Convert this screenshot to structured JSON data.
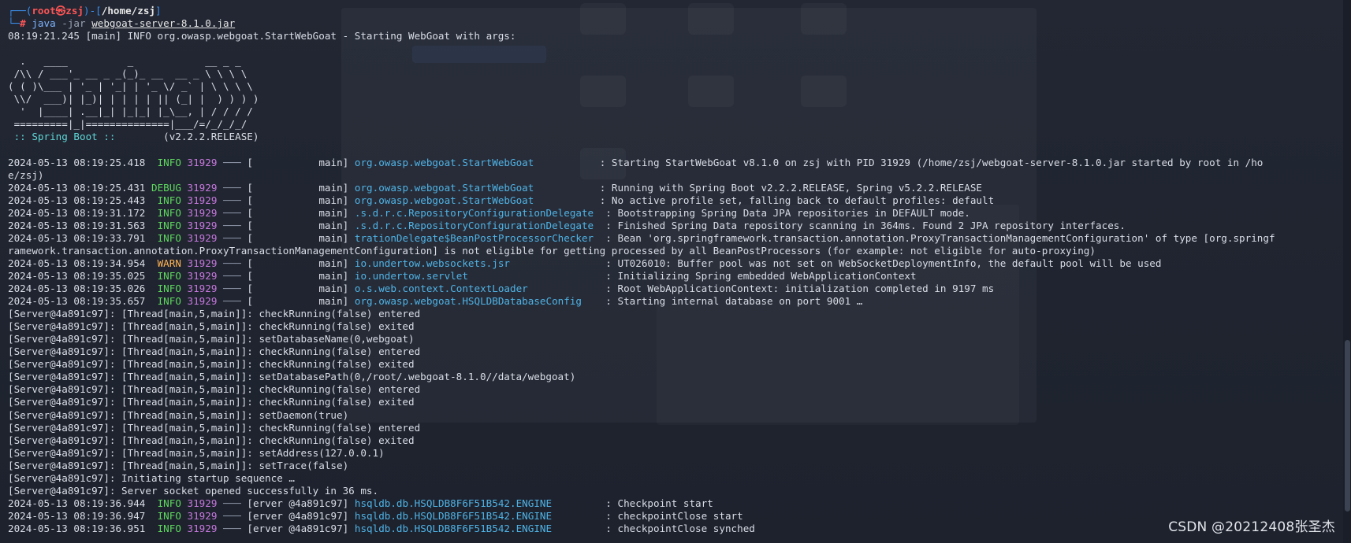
{
  "prompt": {
    "corner_top": "┌──(",
    "user": "root㉿zsj",
    "sep": ")-[",
    "path": "/home/zsj",
    "close": "]",
    "corner_bottom": "└─",
    "symbol": "# ",
    "cmd": "java",
    "arg": " -jar ",
    "file": "webgoat-server-8.1.0.jar"
  },
  "start_line": "08:19:21.245 [main] INFO org.owasp.webgoat.StartWebGoat - Starting WebGoat with args:",
  "banner": [
    "",
    "  .   ____          _            __ _ _",
    " /\\\\ / ___'_ __ _ _(_)_ __  __ _ \\ \\ \\ \\",
    "( ( )\\___ | '_ | '_| | '_ \\/ _` | \\ \\ \\ \\",
    " \\\\/  ___)| |_)| | | | | || (_| |  ) ) ) )",
    "  '  |____| .__|_| |_|_| |_\\__, | / / / /",
    " =========|_|==============|___/=/_/_/_/"
  ],
  "spring_boot": {
    "label": " :: Spring Boot :: ",
    "version": "       (v2.2.2.RELEASE)"
  },
  "log_lines": [
    {
      "type": "log",
      "ts": "2024-05-13 08:19:25.418",
      "level": "INFO",
      "pid": "31929",
      "thread": "[           main]",
      "logger": "org.owasp.webgoat.StartWebGoat          ",
      "msg": ": Starting StartWebGoat v8.1.0 on zsj with PID 31929 (/home/zsj/webgoat-server-8.1.0.jar started by root in /ho"
    },
    {
      "type": "plain",
      "text": "e/zsj)"
    },
    {
      "type": "log",
      "ts": "2024-05-13 08:19:25.431",
      "level": "DEBUG",
      "pid": "31929",
      "thread": "[           main]",
      "logger": "org.owasp.webgoat.StartWebGoat          ",
      "msg": ": Running with Spring Boot v2.2.2.RELEASE, Spring v5.2.2.RELEASE"
    },
    {
      "type": "log",
      "ts": "2024-05-13 08:19:25.443",
      "level": "INFO",
      "pid": "31929",
      "thread": "[           main]",
      "logger": "org.owasp.webgoat.StartWebGoat          ",
      "msg": ": No active profile set, falling back to default profiles: default"
    },
    {
      "type": "log",
      "ts": "2024-05-13 08:19:31.172",
      "level": "INFO",
      "pid": "31929",
      "thread": "[           main]",
      "logger": ".s.d.r.c.RepositoryConfigurationDelegate ",
      "msg": ": Bootstrapping Spring Data JPA repositories in DEFAULT mode."
    },
    {
      "type": "log",
      "ts": "2024-05-13 08:19:31.563",
      "level": "INFO",
      "pid": "31929",
      "thread": "[           main]",
      "logger": ".s.d.r.c.RepositoryConfigurationDelegate ",
      "msg": ": Finished Spring Data repository scanning in 364ms. Found 2 JPA repository interfaces."
    },
    {
      "type": "log",
      "ts": "2024-05-13 08:19:33.791",
      "level": "INFO",
      "pid": "31929",
      "thread": "[           main]",
      "logger": "trationDelegate$BeanPostProcessorChecker ",
      "msg": ": Bean 'org.springframework.transaction.annotation.ProxyTransactionManagementConfiguration' of type [org.springf"
    },
    {
      "type": "plain",
      "text": "ramework.transaction.annotation.ProxyTransactionManagementConfiguration] is not eligible for getting processed by all BeanPostProcessors (for example: not eligible for auto-proxying)"
    },
    {
      "type": "log",
      "ts": "2024-05-13 08:19:34.954",
      "level": "WARN",
      "pid": "31929",
      "thread": "[           main]",
      "logger": "io.undertow.websockets.jsr               ",
      "msg": ": UT026010: Buffer pool was not set on WebSocketDeploymentInfo, the default pool will be used"
    },
    {
      "type": "log",
      "ts": "2024-05-13 08:19:35.025",
      "level": "INFO",
      "pid": "31929",
      "thread": "[           main]",
      "logger": "io.undertow.servlet                      ",
      "msg": ": Initializing Spring embedded WebApplicationContext"
    },
    {
      "type": "log",
      "ts": "2024-05-13 08:19:35.026",
      "level": "INFO",
      "pid": "31929",
      "thread": "[           main]",
      "logger": "o.s.web.context.ContextLoader            ",
      "msg": ": Root WebApplicationContext: initialization completed in 9197 ms"
    },
    {
      "type": "log",
      "ts": "2024-05-13 08:19:35.657",
      "level": "INFO",
      "pid": "31929",
      "thread": "[           main]",
      "logger": "org.owasp.webgoat.HSQLDBDatabaseConfig   ",
      "msg": ": Starting internal database on port 9001 …"
    },
    {
      "type": "plain",
      "text": "[Server@4a891c97]: [Thread[main,5,main]]: checkRunning(false) entered"
    },
    {
      "type": "plain",
      "text": "[Server@4a891c97]: [Thread[main,5,main]]: checkRunning(false) exited"
    },
    {
      "type": "plain",
      "text": "[Server@4a891c97]: [Thread[main,5,main]]: setDatabaseName(0,webgoat)"
    },
    {
      "type": "plain",
      "text": "[Server@4a891c97]: [Thread[main,5,main]]: checkRunning(false) entered"
    },
    {
      "type": "plain",
      "text": "[Server@4a891c97]: [Thread[main,5,main]]: checkRunning(false) exited"
    },
    {
      "type": "plain",
      "text": "[Server@4a891c97]: [Thread[main,5,main]]: setDatabasePath(0,/root/.webgoat-8.1.0//data/webgoat)"
    },
    {
      "type": "plain",
      "text": "[Server@4a891c97]: [Thread[main,5,main]]: checkRunning(false) entered"
    },
    {
      "type": "plain",
      "text": "[Server@4a891c97]: [Thread[main,5,main]]: checkRunning(false) exited"
    },
    {
      "type": "plain",
      "text": "[Server@4a891c97]: [Thread[main,5,main]]: setDaemon(true)"
    },
    {
      "type": "plain",
      "text": "[Server@4a891c97]: [Thread[main,5,main]]: checkRunning(false) entered"
    },
    {
      "type": "plain",
      "text": "[Server@4a891c97]: [Thread[main,5,main]]: checkRunning(false) exited"
    },
    {
      "type": "plain",
      "text": "[Server@4a891c97]: [Thread[main,5,main]]: setAddress(127.0.0.1)"
    },
    {
      "type": "plain",
      "text": "[Server@4a891c97]: [Thread[main,5,main]]: setTrace(false)"
    },
    {
      "type": "plain",
      "text": "[Server@4a891c97]: Initiating startup sequence …"
    },
    {
      "type": "plain",
      "text": "[Server@4a891c97]: Server socket opened successfully in 36 ms."
    },
    {
      "type": "log",
      "ts": "2024-05-13 08:19:36.944",
      "level": "INFO",
      "pid": "31929",
      "thread": "[erver @4a891c97]",
      "logger": "hsqldb.db.HSQLDB8F6F51B542.ENGINE        ",
      "msg": ": Checkpoint start"
    },
    {
      "type": "log",
      "ts": "2024-05-13 08:19:36.947",
      "level": "INFO",
      "pid": "31929",
      "thread": "[erver @4a891c97]",
      "logger": "hsqldb.db.HSQLDB8F6F51B542.ENGINE        ",
      "msg": ": checkpointClose start"
    },
    {
      "type": "log",
      "ts": "2024-05-13 08:19:36.951",
      "level": "INFO",
      "pid": "31929",
      "thread": "[erver @4a891c97]",
      "logger": "hsqldb.db.HSQLDB8F6F51B542.ENGINE        ",
      "msg": ": checkpointClose synched"
    }
  ],
  "dash": "───",
  "watermark": "CSDN @20212408张圣杰"
}
